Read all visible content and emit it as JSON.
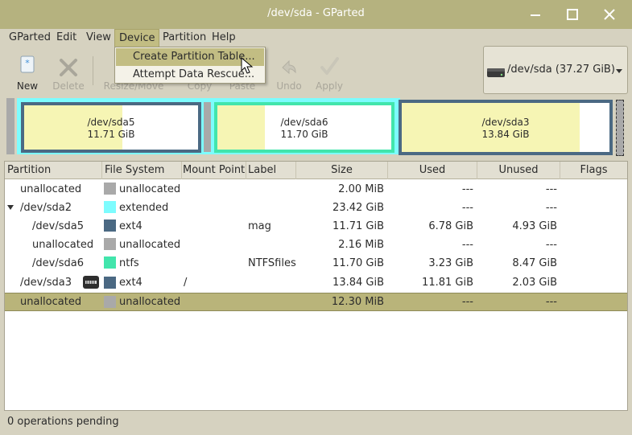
{
  "window": {
    "title": "/dev/sda - GParted"
  },
  "menubar": [
    "GParted",
    "Edit",
    "View",
    "Device",
    "Partition",
    "Help"
  ],
  "device_menu": {
    "items": [
      "Create Partition Table...",
      "Attempt Data Rescue..."
    ]
  },
  "toolbar": {
    "new": "New",
    "delete": "Delete",
    "resize": "Resize/Move",
    "copy": "Copy",
    "paste": "Paste",
    "undo": "Undo",
    "apply": "Apply"
  },
  "device_selector": {
    "label": "/dev/sda  (37.27 GiB)"
  },
  "diskmap": [
    {
      "name": "/dev/sda5",
      "size": "11.71 GiB"
    },
    {
      "name": "/dev/sda6",
      "size": "11.70 GiB"
    },
    {
      "name": "/dev/sda3",
      "size": "13.84 GiB"
    }
  ],
  "table": {
    "headers": [
      "Partition",
      "File System",
      "Mount Point",
      "Label",
      "Size",
      "Used",
      "Unused",
      "Flags"
    ],
    "rows": [
      {
        "partition": "unallocated",
        "fs": "unallocated",
        "mount": "",
        "label": "",
        "size": "2.00 MiB",
        "used": "---",
        "unused": "---",
        "flags": ""
      },
      {
        "partition": "/dev/sda2",
        "fs": "extended",
        "mount": "",
        "label": "",
        "size": "23.42 GiB",
        "used": "---",
        "unused": "---",
        "flags": ""
      },
      {
        "partition": "/dev/sda5",
        "fs": "ext4",
        "mount": "",
        "label": "mag",
        "size": "11.71 GiB",
        "used": "6.78 GiB",
        "unused": "4.93 GiB",
        "flags": ""
      },
      {
        "partition": "unallocated",
        "fs": "unallocated",
        "mount": "",
        "label": "",
        "size": "2.16 MiB",
        "used": "---",
        "unused": "---",
        "flags": ""
      },
      {
        "partition": "/dev/sda6",
        "fs": "ntfs",
        "mount": "",
        "label": "NTFSfiles",
        "size": "11.70 GiB",
        "used": "3.23 GiB",
        "unused": "8.47 GiB",
        "flags": ""
      },
      {
        "partition": "/dev/sda3",
        "fs": "ext4",
        "mount": "/",
        "label": "",
        "size": "13.84 GiB",
        "used": "11.81 GiB",
        "unused": "2.03 GiB",
        "flags": ""
      },
      {
        "partition": "unallocated",
        "fs": "unallocated",
        "mount": "",
        "label": "",
        "size": "12.30 MiB",
        "used": "---",
        "unused": "---",
        "flags": ""
      }
    ]
  },
  "colors": {
    "unallocated": "#a9a9a9",
    "extended": "#7dfcfe",
    "ext4": "#4b6983",
    "ntfs": "#42e5ac",
    "selection": "#b9b47a"
  },
  "status": {
    "text": "0 operations pending"
  }
}
